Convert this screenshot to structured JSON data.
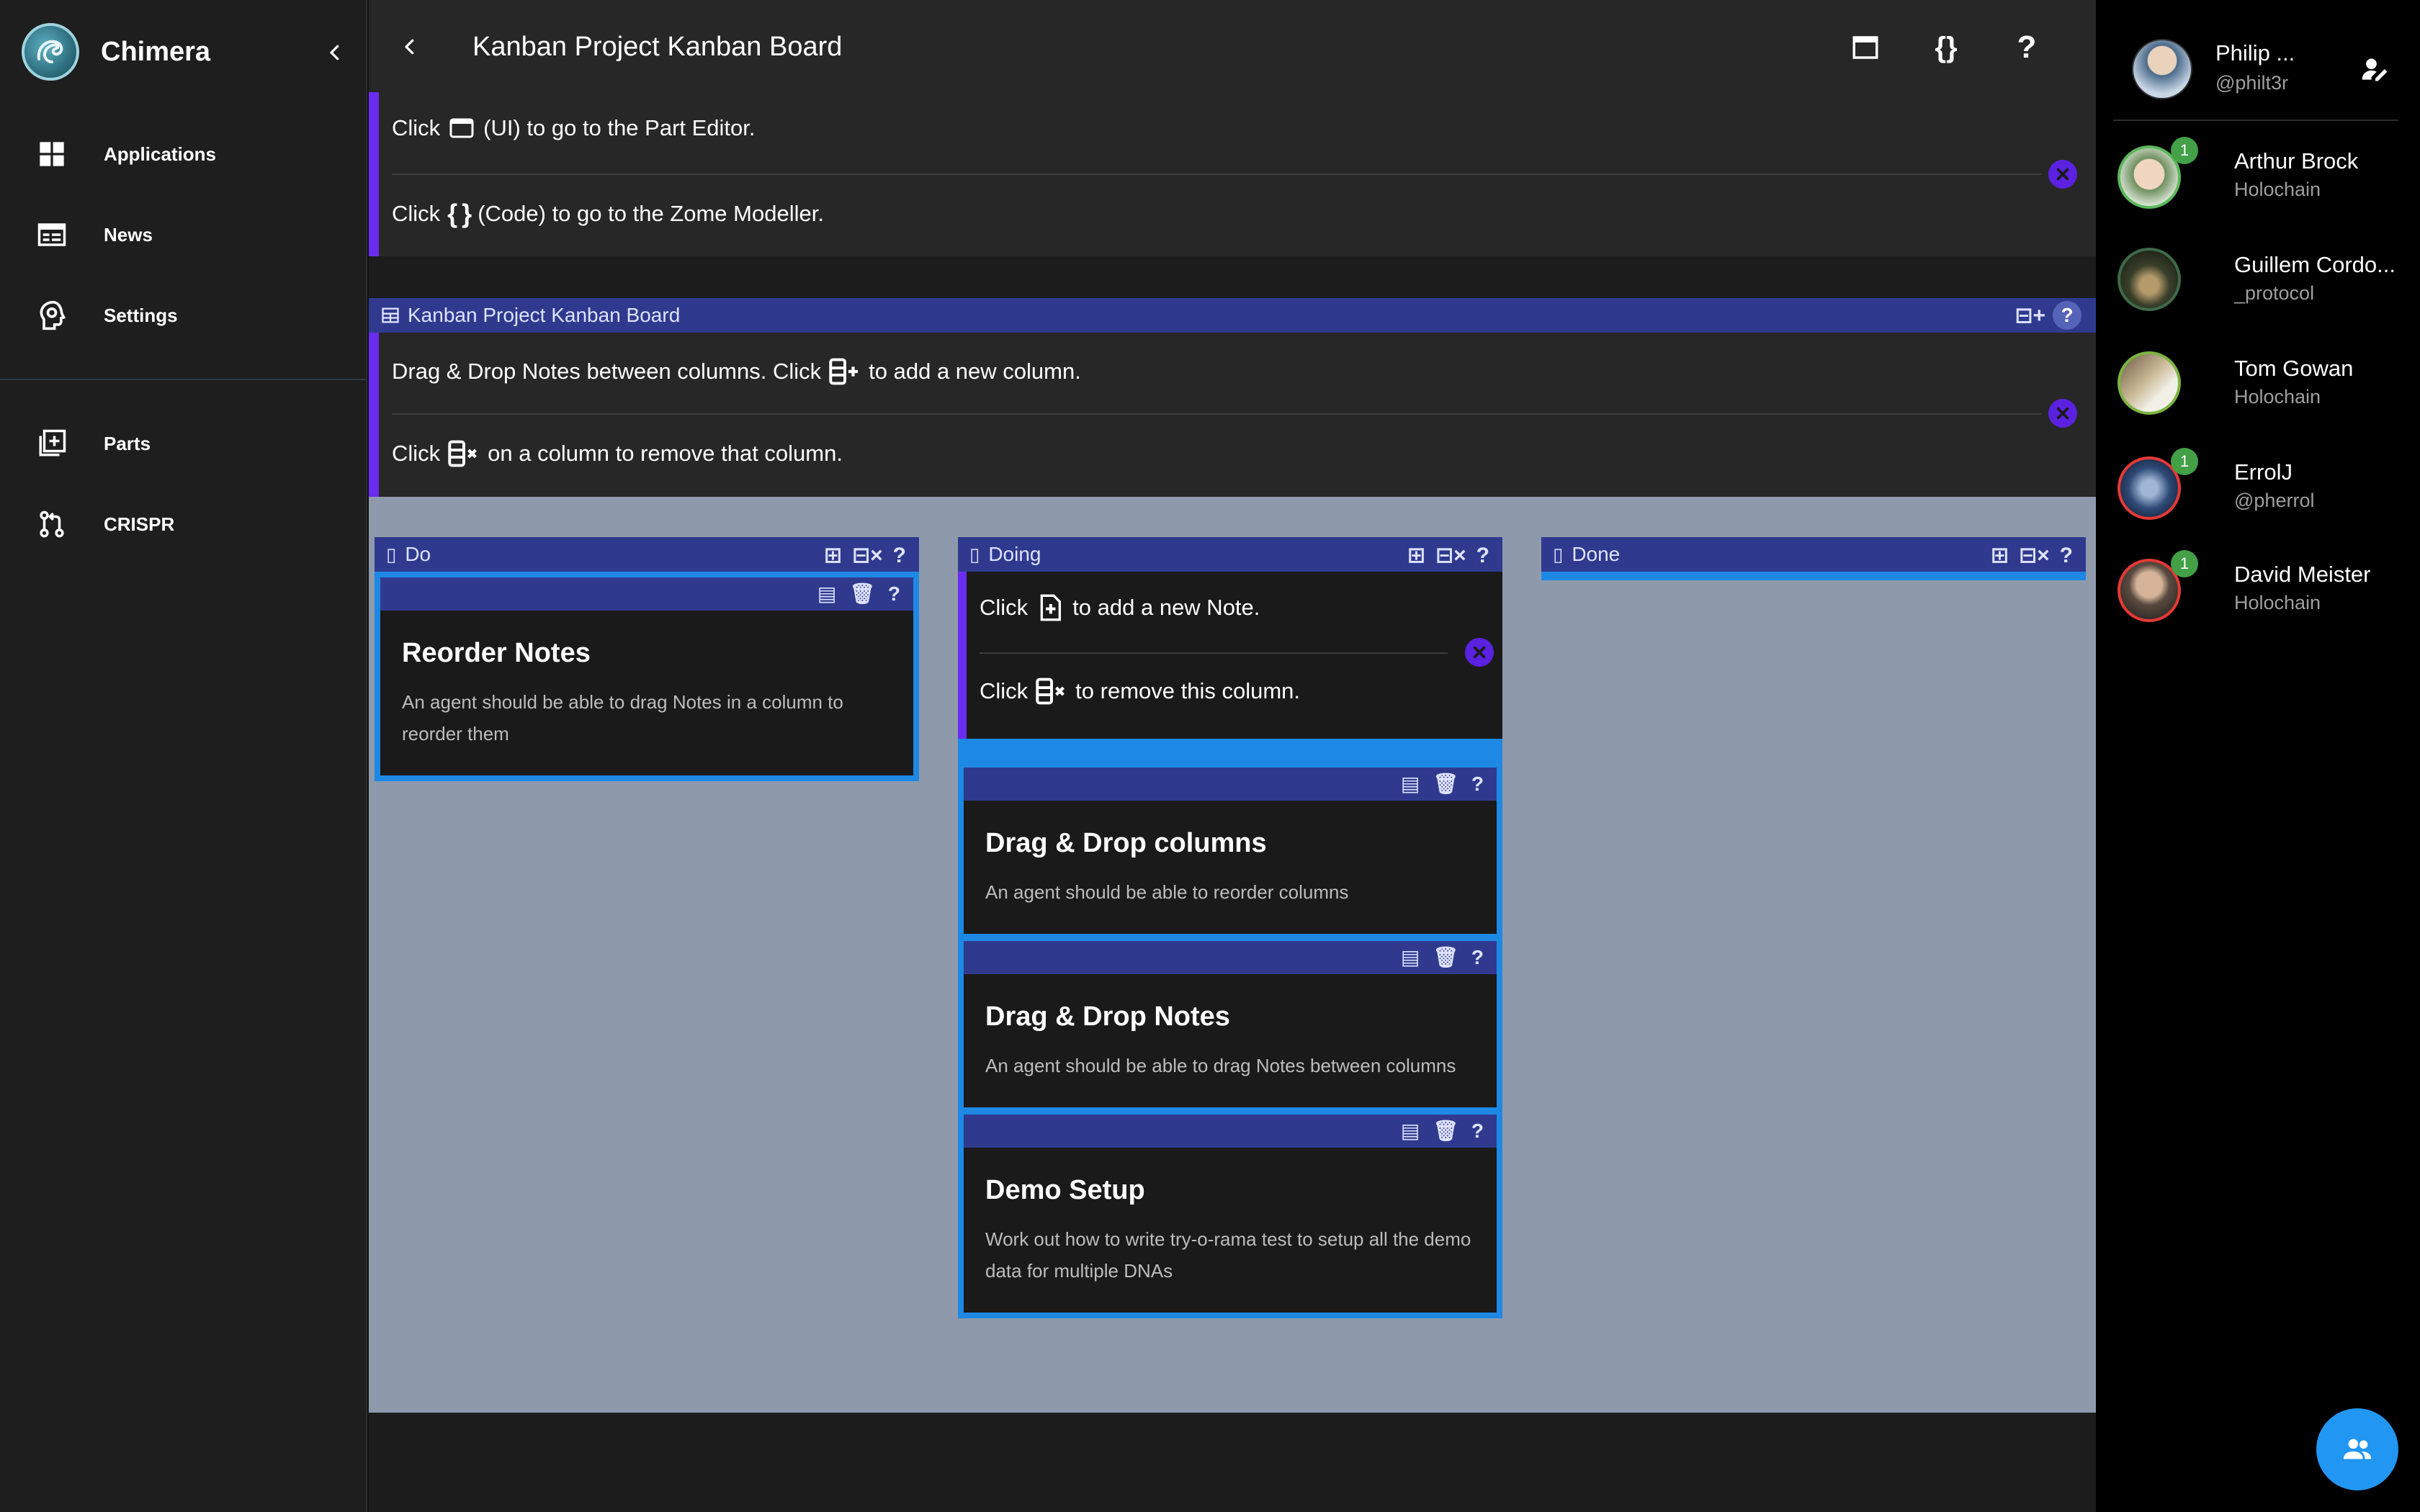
{
  "app": {
    "name": "Chimera"
  },
  "nav": {
    "items": [
      {
        "label": "Applications",
        "icon": "grid-icon"
      },
      {
        "label": "News",
        "icon": "newspaper-icon"
      },
      {
        "label": "Settings",
        "icon": "head-gear-icon"
      },
      {
        "label": "Parts",
        "icon": "library-add-icon"
      },
      {
        "label": "CRISPR",
        "icon": "source-pull-icon"
      }
    ]
  },
  "header": {
    "title": "Kanban Project Kanban Board"
  },
  "help_top": {
    "line1_pre": "Click",
    "line1_post": "(UI) to go to the Part Editor.",
    "line2_pre": "Click",
    "line2_mid": "{ }",
    "line2_post": "(Code) to go to the Zome Modeller."
  },
  "board": {
    "title": "Kanban Project Kanban Board",
    "help": {
      "line1_pre": "Drag & Drop Notes between columns. Click",
      "line1_post": "to add a new column.",
      "line2_pre": "Click",
      "line2_post": "on a column to remove that column."
    },
    "columns": [
      {
        "title": "Do",
        "notes": [
          {
            "title": "Reorder Notes",
            "desc": "An agent should be able to drag Notes in a column to reorder them"
          }
        ]
      },
      {
        "title": "Doing",
        "help": {
          "line1_pre": "Click",
          "line1_post": "to add a new Note.",
          "line2_pre": "Click",
          "line2_post": "to remove this column."
        },
        "notes": [
          {
            "title": "Drag & Drop columns",
            "desc": "An agent should be able to reorder columns"
          },
          {
            "title": "Drag & Drop Notes",
            "desc": "An agent should be able to drag Notes between columns"
          },
          {
            "title": "Demo Setup",
            "desc": "Work out how to write try-o-rama test to setup all the demo data for multiple DNAs"
          }
        ]
      },
      {
        "title": "Done",
        "notes": []
      }
    ]
  },
  "people": {
    "me": {
      "name": "Philip ...",
      "handle": "@philt3r"
    },
    "list": [
      {
        "name": "Arthur Brock",
        "sub": "Holochain",
        "badge": "1"
      },
      {
        "name": "Guillem Cordo...",
        "sub": "_protocol",
        "badge": ""
      },
      {
        "name": "Tom Gowan",
        "sub": "Holochain",
        "badge": ""
      },
      {
        "name": "ErrolJ",
        "sub": "@pherrol",
        "badge": "1"
      },
      {
        "name": "David Meister",
        "sub": "Holochain",
        "badge": "1"
      }
    ]
  },
  "colors": {
    "accent": "#6a2cf0",
    "dismiss": "#5b21e0",
    "header_blue": "#2f3a8f",
    "column_blue": "#1e88e5",
    "board_bg": "#8e9aab",
    "fab": "#2196f3",
    "badge": "#43a047"
  }
}
